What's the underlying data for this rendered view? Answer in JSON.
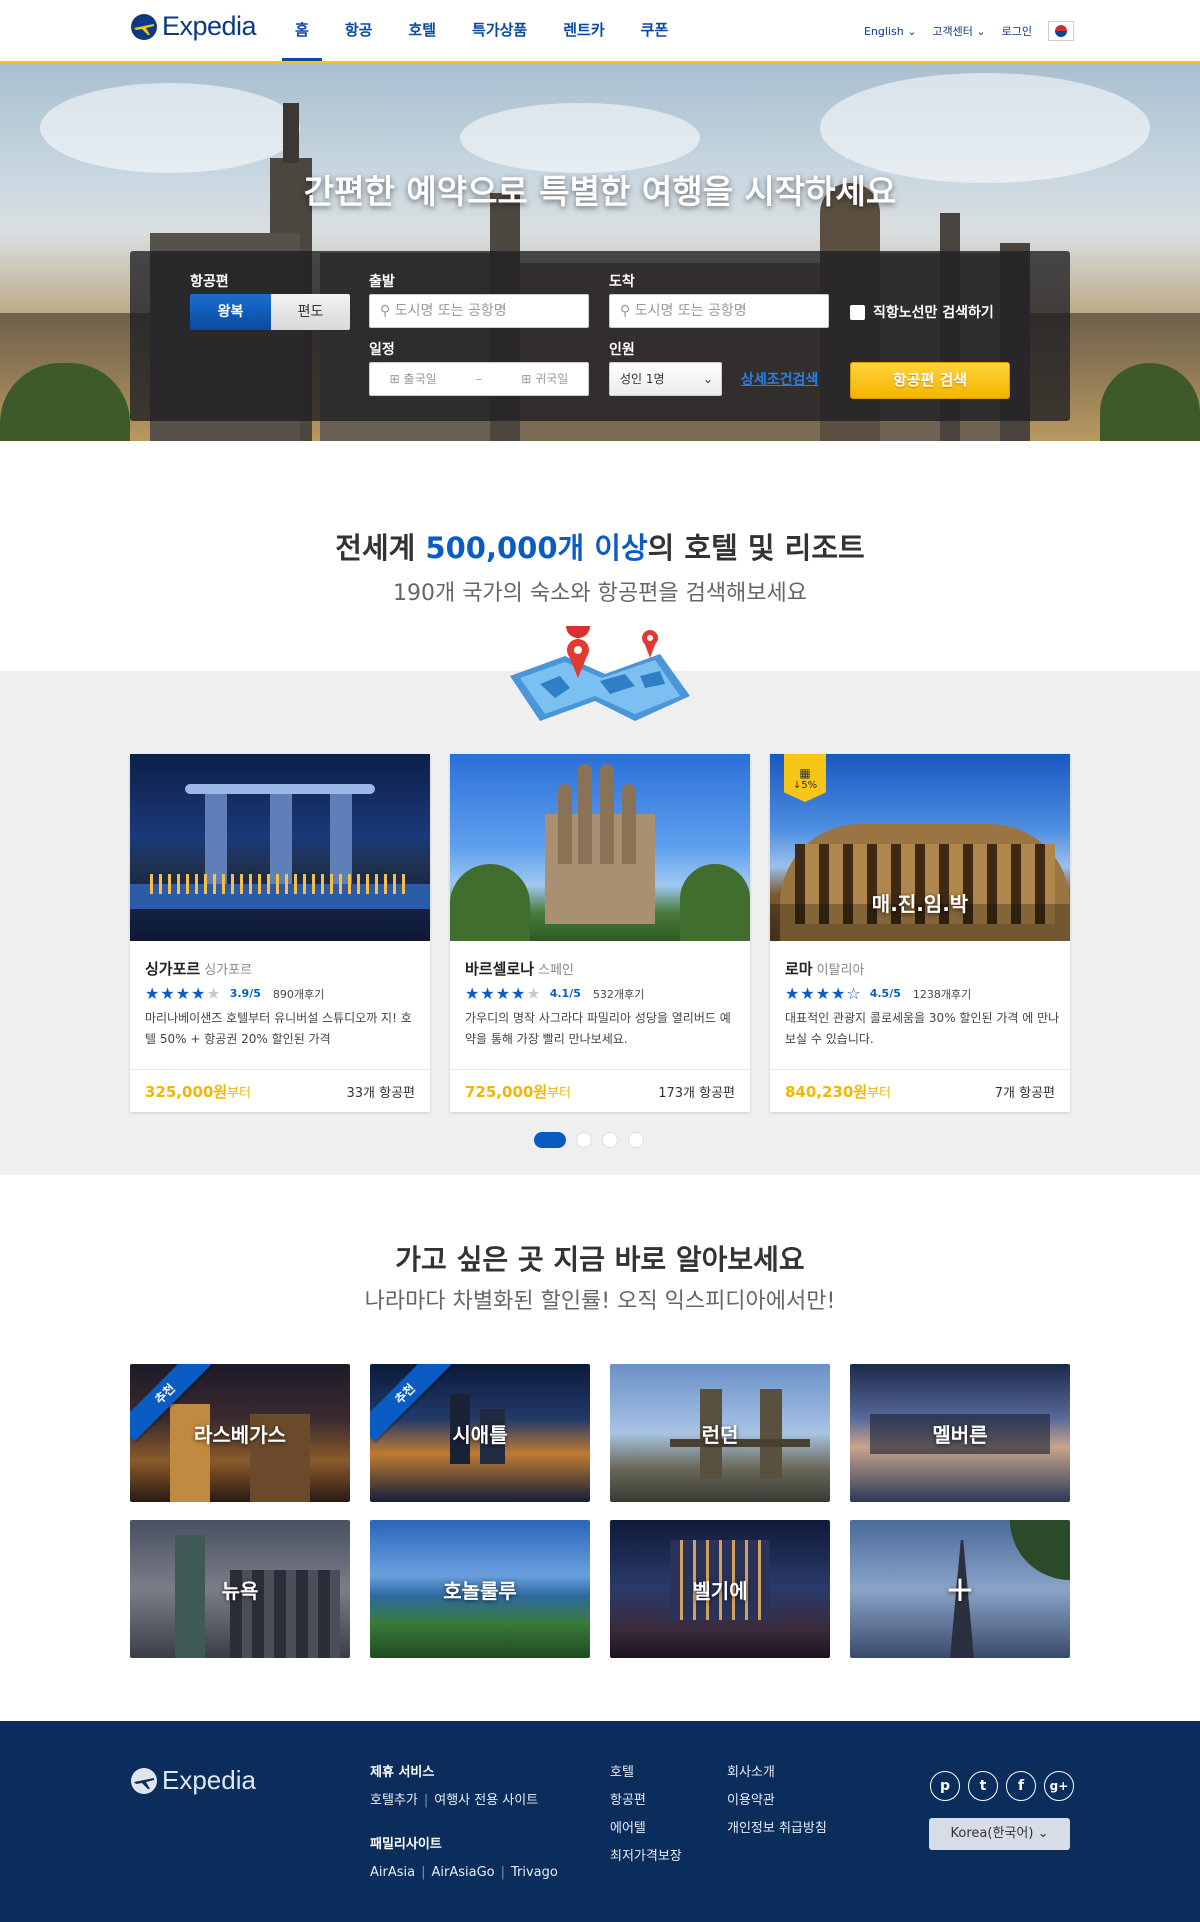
{
  "header": {
    "logo_text": "Expedia",
    "nav": [
      "홈",
      "항공",
      "호텔",
      "특가상품",
      "렌트카",
      "쿠폰"
    ],
    "language": "English",
    "support": "고객센터",
    "login": "로그인"
  },
  "hero": {
    "headline": "간편한 예약으로 특별한 여행을 시작하세요",
    "flight_label": "항공편",
    "roundtrip": "왕복",
    "oneway": "편도",
    "from_label": "출발",
    "from_placeholder": "도시명 또는 공항명",
    "to_label": "도착",
    "to_placeholder": "도시명 또는 공항명",
    "direct_only": "직항노선만 검색하기",
    "schedule_label": "일정",
    "depart_date": "출국일",
    "date_dash": "–",
    "return_date": "귀국일",
    "pax_label": "인원",
    "pax_value": "성인 1명",
    "advanced": "상세조건검색",
    "search_button": "항공편 검색"
  },
  "section_hotels": {
    "title_prefix": "전세계 ",
    "title_highlight": "500,000개 이상",
    "title_suffix": "의 호텔 및 리조트",
    "subtitle": "190개 국가의 숙소와 항공편을 검색해보세요",
    "cards": [
      {
        "city": "싱가포르",
        "country": "싱가포르",
        "rating_value": 3.9,
        "score": "3.9/5",
        "reviews": "890개후기",
        "desc": "마리나베이샌즈 호텔부터 유니버설 스튜디오까 지! 호텔 50% + 항공권 20% 할인된 가격",
        "price": "325,000원",
        "price_suffix": "부터",
        "flights": "33개 항공편"
      },
      {
        "city": "바르셀로나",
        "country": "스페인",
        "rating_value": 4.1,
        "score": "4.1/5",
        "reviews": "532개후기",
        "desc": "가우디의 명작 사그라다 파밀리아 성당을 열리버드 예약을 통해 가장 빨리 만나보세요.",
        "price": "725,000원",
        "price_suffix": "부터",
        "flights": "173개 항공편"
      },
      {
        "city": "로마",
        "country": "이탈리아",
        "rating_value": 4.5,
        "score": "4.5/5",
        "reviews": "1238개후기",
        "desc": "대표적인 관광지 콜로세움을 30% 할인된 가격 에 만나보실 수 있습니다.",
        "price": "840,230원",
        "price_suffix": "부터",
        "flights": "7개 항공편",
        "badge": "↓5%",
        "overlay": "매.진.임.박"
      }
    ],
    "carousel_pages": 4,
    "carousel_active": 1
  },
  "section_destinations": {
    "title": "가고 싶은 곳 지금 바로 알아보세요",
    "subtitle": "나라마다 차별화된 할인률! 오직 익스피디아에서만!",
    "ribbon": "추천",
    "tiles": [
      "라스베가스",
      "시애틀",
      "런던",
      "멜버른",
      "뉴욕",
      "호놀룰루",
      "벨기에",
      "+"
    ]
  },
  "footer": {
    "logo_text": "Expedia",
    "partner_title": "제휴 서비스",
    "partner_links": [
      "호텔추가",
      "여행사 전용 사이트"
    ],
    "family_title": "패밀리사이트",
    "family_links": [
      "AirAsia",
      "AirAsiaGo",
      "Trivago"
    ],
    "col3": [
      "호텔",
      "항공편",
      "에어텔",
      "최저가격보장"
    ],
    "col4": [
      "회사소개",
      "이용약관",
      "개인정보 취급방침"
    ],
    "social": [
      "p",
      "t",
      "f",
      "g+"
    ],
    "region": "Korea(한국어)"
  }
}
